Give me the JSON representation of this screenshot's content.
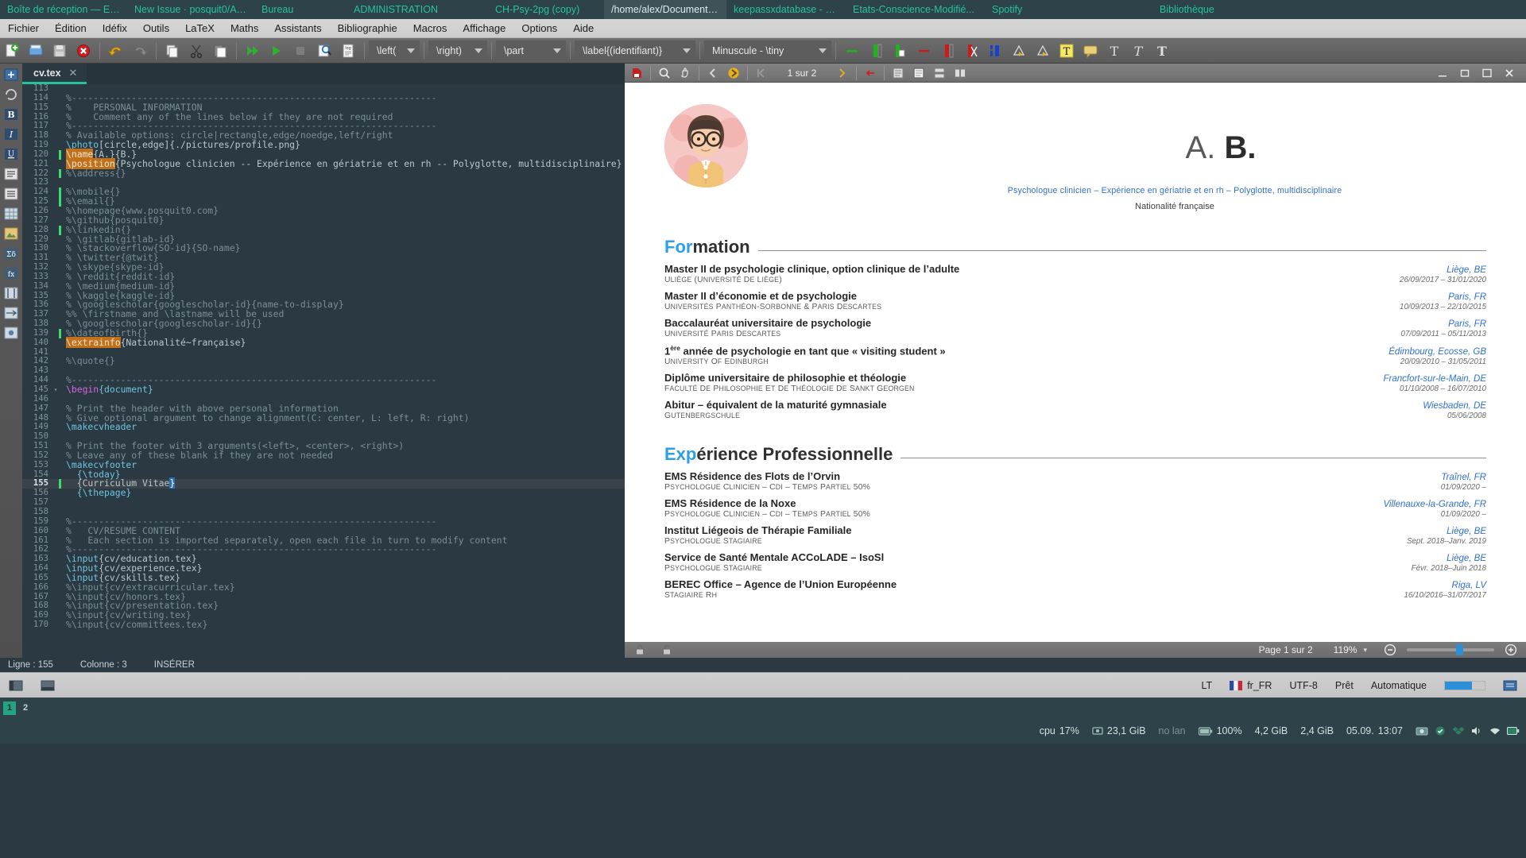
{
  "taskbar": {
    "items": [
      {
        "label": "Boîte de réception — Evo...",
        "active": false
      },
      {
        "label": "New Issue · posquit0/Aw...",
        "active": false
      },
      {
        "label": "Bureau",
        "active": false
      },
      {
        "label": "ADMINISTRATION",
        "active": false
      },
      {
        "label": "CH-Psy-2pg (copy)",
        "active": false
      },
      {
        "label": "/home/alex/Documents/A...",
        "active": true
      },
      {
        "label": "keepassxdatabase - KeeP...",
        "active": false
      },
      {
        "label": "Etats-Conscience-Modifié...",
        "active": false
      },
      {
        "label": "Spotify",
        "active": false
      },
      {
        "label": "Bibliothèque",
        "active": false
      }
    ]
  },
  "menubar": {
    "items": [
      "Fichier",
      "Édition",
      "Idéfix",
      "Outils",
      "LaTeX",
      "Maths",
      "Assistants",
      "Bibliographie",
      "Macros",
      "Affichage",
      "Options",
      "Aide"
    ]
  },
  "toolbar": {
    "combos": [
      {
        "label": "\\left(",
        "name": "left-delimiter-combo"
      },
      {
        "label": "\\right)",
        "name": "right-delimiter-combo"
      },
      {
        "label": "\\part",
        "name": "section-level-combo"
      },
      {
        "label": "\\label{(identifiant)}",
        "name": "label-combo"
      },
      {
        "label": "Minuscule - \\tiny",
        "name": "font-size-combo"
      }
    ]
  },
  "editor": {
    "tab": {
      "filename": "cv.tex",
      "close": "✕"
    },
    "status": {
      "line": "Ligne : 155",
      "column": "Colonne : 3",
      "mode": "INSÉRER"
    },
    "lines": [
      {
        "n": 113,
        "mark": "",
        "fold": "",
        "text": "",
        "type": "plain"
      },
      {
        "n": 114,
        "mark": "",
        "fold": "",
        "text": "%-------------------------------------------------------------------",
        "type": "cmt"
      },
      {
        "n": 115,
        "mark": "",
        "fold": "",
        "text": "%    PERSONAL INFORMATION",
        "type": "cmt"
      },
      {
        "n": 116,
        "mark": "",
        "fold": "",
        "text": "%    Comment any of the lines below if they are not required",
        "type": "cmt"
      },
      {
        "n": 117,
        "mark": "",
        "fold": "",
        "text": "%-------------------------------------------------------------------",
        "type": "cmt"
      },
      {
        "n": 118,
        "mark": "",
        "fold": "",
        "text": "% Available options: circle|rectangle,edge/noedge,left/right",
        "type": "cmt"
      },
      {
        "n": 119,
        "mark": "",
        "fold": "",
        "text": "\\photo[circle,edge]{./pictures/profile.png}",
        "type": "photo"
      },
      {
        "n": 120,
        "mark": "green",
        "fold": "",
        "text": "\\name{A.}{B.}",
        "type": "hl-name"
      },
      {
        "n": 121,
        "mark": "",
        "fold": "",
        "text": "\\position{Psychologue clinicien -- Expérience en gériatrie et en rh -- Polyglotte, multidisciplinaire}",
        "type": "hl-position"
      },
      {
        "n": 122,
        "mark": "green",
        "fold": "",
        "text": "%\\address{}",
        "type": "cmt"
      },
      {
        "n": 123,
        "mark": "",
        "fold": "",
        "text": "",
        "type": "plain"
      },
      {
        "n": 124,
        "mark": "green",
        "fold": "",
        "text": "%\\mobile{}",
        "type": "cmt"
      },
      {
        "n": 125,
        "mark": "green",
        "fold": "",
        "text": "%\\email{}",
        "type": "cmt"
      },
      {
        "n": 126,
        "mark": "",
        "fold": "",
        "text": "%\\homepage{www.posquit0.com}",
        "type": "cmt"
      },
      {
        "n": 127,
        "mark": "",
        "fold": "",
        "text": "%\\github{posquit0}",
        "type": "cmt"
      },
      {
        "n": 128,
        "mark": "green",
        "fold": "",
        "text": "%\\linkedin{}",
        "type": "cmt"
      },
      {
        "n": 129,
        "mark": "",
        "fold": "",
        "text": "% \\gitlab{gitlab-id}",
        "type": "cmt"
      },
      {
        "n": 130,
        "mark": "",
        "fold": "",
        "text": "% \\stackoverflow{SO-id}{SO-name}",
        "type": "cmt"
      },
      {
        "n": 131,
        "mark": "",
        "fold": "",
        "text": "% \\twitter{@twit}",
        "type": "cmt"
      },
      {
        "n": 132,
        "mark": "",
        "fold": "",
        "text": "% \\skype{skype-id}",
        "type": "cmt"
      },
      {
        "n": 133,
        "mark": "",
        "fold": "",
        "text": "% \\reddit{reddit-id}",
        "type": "cmt"
      },
      {
        "n": 134,
        "mark": "",
        "fold": "",
        "text": "% \\medium{medium-id}",
        "type": "cmt"
      },
      {
        "n": 135,
        "mark": "",
        "fold": "",
        "text": "% \\kaggle{kaggle-id}",
        "type": "cmt"
      },
      {
        "n": 136,
        "mark": "",
        "fold": "",
        "text": "% \\googlescholar{googlescholar-id}{name-to-display}",
        "type": "cmt"
      },
      {
        "n": 137,
        "mark": "",
        "fold": "",
        "text": "%% \\firstname and \\lastname will be used",
        "type": "cmt"
      },
      {
        "n": 138,
        "mark": "",
        "fold": "",
        "text": "% \\googlescholar{googlescholar-id}{}",
        "type": "cmt"
      },
      {
        "n": 139,
        "mark": "green",
        "fold": "",
        "text": "%\\dateofbirth{}",
        "type": "cmt"
      },
      {
        "n": 140,
        "mark": "",
        "fold": "",
        "text": "\\extrainfo{Nationalité~française}",
        "type": "hl-extrainfo"
      },
      {
        "n": 141,
        "mark": "",
        "fold": "",
        "text": "",
        "type": "plain"
      },
      {
        "n": 142,
        "mark": "",
        "fold": "",
        "text": "%\\quote{}",
        "type": "cmt"
      },
      {
        "n": 143,
        "mark": "",
        "fold": "",
        "text": "",
        "type": "plain"
      },
      {
        "n": 144,
        "mark": "",
        "fold": "",
        "text": "%-------------------------------------------------------------------",
        "type": "cmt"
      },
      {
        "n": 145,
        "mark": "",
        "fold": "▾",
        "text": "\\begin{document}",
        "type": "env"
      },
      {
        "n": 146,
        "mark": "",
        "fold": "",
        "text": "",
        "type": "plain"
      },
      {
        "n": 147,
        "mark": "",
        "fold": "",
        "text": "% Print the header with above personal information",
        "type": "cmt"
      },
      {
        "n": 148,
        "mark": "",
        "fold": "",
        "text": "% Give optional argument to change alignment(C: center, L: left, R: right)",
        "type": "cmt"
      },
      {
        "n": 149,
        "mark": "",
        "fold": "",
        "text": "\\makecvheader",
        "type": "cmd"
      },
      {
        "n": 150,
        "mark": "",
        "fold": "",
        "text": "",
        "type": "plain"
      },
      {
        "n": 151,
        "mark": "",
        "fold": "",
        "text": "% Print the footer with 3 arguments(<left>, <center>, <right>)",
        "type": "cmt"
      },
      {
        "n": 152,
        "mark": "",
        "fold": "",
        "text": "% Leave any of these blank if they are not needed",
        "type": "cmt"
      },
      {
        "n": 153,
        "mark": "",
        "fold": "",
        "text": "\\makecvfooter",
        "type": "cmd"
      },
      {
        "n": 154,
        "mark": "",
        "fold": "",
        "text": "  {\\today}",
        "type": "brace"
      },
      {
        "n": 155,
        "mark": "green",
        "fold": "",
        "text": "  {Curriculum Vitae}",
        "type": "sel-curriculum",
        "highlight": true
      },
      {
        "n": 156,
        "mark": "",
        "fold": "",
        "text": "  {\\thepage}",
        "type": "brace"
      },
      {
        "n": 157,
        "mark": "",
        "fold": "",
        "text": "",
        "type": "plain"
      },
      {
        "n": 158,
        "mark": "",
        "fold": "",
        "text": "",
        "type": "plain"
      },
      {
        "n": 159,
        "mark": "",
        "fold": "",
        "text": "%-------------------------------------------------------------------",
        "type": "cmt"
      },
      {
        "n": 160,
        "mark": "",
        "fold": "",
        "text": "%   CV/RESUME CONTENT",
        "type": "cmt"
      },
      {
        "n": 161,
        "mark": "",
        "fold": "",
        "text": "%   Each section is imported separately, open each file in turn to modify content",
        "type": "cmt"
      },
      {
        "n": 162,
        "mark": "",
        "fold": "",
        "text": "%-------------------------------------------------------------------",
        "type": "cmt"
      },
      {
        "n": 163,
        "mark": "",
        "fold": "",
        "text": "\\input{cv/education.tex}",
        "type": "input"
      },
      {
        "n": 164,
        "mark": "",
        "fold": "",
        "text": "\\input{cv/experience.tex}",
        "type": "input"
      },
      {
        "n": 165,
        "mark": "",
        "fold": "",
        "text": "\\input{cv/skills.tex}",
        "type": "input"
      },
      {
        "n": 166,
        "mark": "",
        "fold": "",
        "text": "%\\input{cv/extracurricular.tex}",
        "type": "cmt"
      },
      {
        "n": 167,
        "mark": "",
        "fold": "",
        "text": "%\\input{cv/honors.tex}",
        "type": "cmt"
      },
      {
        "n": 168,
        "mark": "",
        "fold": "",
        "text": "%\\input{cv/presentation.tex}",
        "type": "cmt"
      },
      {
        "n": 169,
        "mark": "",
        "fold": "",
        "text": "%\\input{cv/writing.tex}",
        "type": "cmt"
      },
      {
        "n": 170,
        "mark": "",
        "fold": "",
        "text": "%\\input{cv/committees.tex}",
        "type": "cmt"
      }
    ]
  },
  "pdf": {
    "page_indicator": "1 sur 2",
    "status_page": "Page 1 sur 2",
    "zoom": "119%",
    "zoom_out": "−",
    "zoom_in": "+"
  },
  "cv": {
    "name_first": "A.",
    "name_last": "B.",
    "position": "Psychologue clinicien – Expérience en gériatrie et en rh – Polyglotte, multidisciplinaire",
    "extrainfo": "Nationalité française",
    "sections": [
      {
        "accent": "For",
        "rest": "mation",
        "entries": [
          {
            "title": "Master II de psychologie clinique, option clinique de l’adulte",
            "location": "Liège, BE",
            "org": "ULiège (Université de Liège)",
            "date": "26/09/2017 – 31/01/2020"
          },
          {
            "title": "Master II d’économie et de psychologie",
            "location": "Paris, FR",
            "org": "Universités Panthéon-Sorbonne & Paris Descartes",
            "date": "10/09/2013 – 22/10/2015"
          },
          {
            "title": "Baccalauréat universitaire de psychologie",
            "location": "Paris, FR",
            "org": "Université Paris Descartes",
            "date": "07/09/2011 – 05/11/2013"
          },
          {
            "title": "1ère année de psychologie en tant que « visiting student »",
            "title_pre": "1",
            "title_sup": "ère",
            "title_post": " année de psychologie en tant que « visiting student »",
            "location": "Édimbourg, Ecosse, GB",
            "org": "University of Edinburgh",
            "date": "20/09/2010 – 31/05/2011"
          },
          {
            "title": "Diplôme universitaire de philosophie et théologie",
            "location": "Francfort-sur-le-Main, DE",
            "org": "Faculté de Philosophie et de Théologie de Sankt Georgen",
            "date": "01/10/2008 – 16/07/2010"
          },
          {
            "title": "Abitur – équivalent de la maturité gymnasiale",
            "location": "Wiesbaden, DE",
            "org": "Gutenbergschule",
            "date": "05/06/2008"
          }
        ]
      },
      {
        "accent": "Exp",
        "rest": "érience Professionnelle",
        "entries": [
          {
            "title": "EMS Résidence des Flots de l’Orvin",
            "location": "Traînel, FR",
            "org": "Psychologue clinicien – CDI – temps partiel 50%",
            "date": "01/09/2020 –"
          },
          {
            "title": "EMS Résidence de la Noxe",
            "location": "Villenauxe-la-Grande, FR",
            "org": "Psychologue clinicien – CDI – temps partiel 50%",
            "date": "01/09/2020 –"
          },
          {
            "title": "Institut Liégeois de Thérapie Familiale",
            "location": "Liège, BE",
            "org": "Psychologue stagiaire",
            "date": "Sept. 2018–Janv. 2019"
          },
          {
            "title": "Service de Santé Mentale ACCoLADE – IsoSl",
            "location": "Liège, BE",
            "org": "Psychologue stagiaire",
            "date": "Févr. 2018–Juin 2018"
          },
          {
            "title": "BEREC Office – Agence de l’Union Européenne",
            "location": "Riga, LV",
            "org": "Stagiaire RH",
            "date": "16/10/2016–31/07/2017"
          }
        ]
      }
    ]
  },
  "statusbar": {
    "keyboard": "LT",
    "locale": "fr_FR",
    "encoding": "UTF-8",
    "state": "Prêt",
    "mode": "Automatique"
  },
  "panelbar": {
    "workspaces": [
      "1",
      "2"
    ]
  },
  "sysbar": {
    "cpu_label": "cpu",
    "cpu_value": "17%",
    "disk": "23,1 GiB",
    "network": "no lan",
    "battery": "100%",
    "mem_used": "4,2 GiB",
    "mem_total": "2,4 GiB",
    "date": "05.09.",
    "time": "13:07"
  }
}
